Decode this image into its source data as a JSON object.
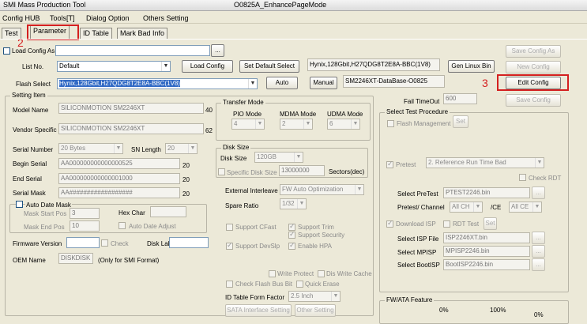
{
  "window": {
    "title": "SMI Mass Production Tool",
    "subtitle": "O0825A_EnhancePageMode"
  },
  "menu": [
    "Config HUB",
    "Tools[T]",
    "Dialog Option",
    "Others Setting"
  ],
  "tabs": [
    "Test",
    "Parameter",
    "ID Table",
    "Mark Bad Info"
  ],
  "annotations": {
    "n2": "2",
    "n3": "3"
  },
  "top": {
    "load_config_as": "Load Config As",
    "browse": "...",
    "list_no_label": "List No.",
    "list_no_value": "Default",
    "load_config": "Load Config",
    "set_default_select": "Set Default Select",
    "flash_info": "Hynix,128Gbit,H27QDG8T2E8A-BBC(1V8)",
    "gen_linux_bin": "Gen Linux Bin",
    "flash_select_label": "Flash Select",
    "flash_select_value": "Hynix,128Gbit,H27QDG8T2E8A-BBC(1V8)",
    "auto": "Auto",
    "manual": "Manual",
    "database": "SM2246XT-DataBase-O0825",
    "save_config_as": "Save Config As",
    "new_config": "New Config",
    "edit_config": "Edit Config",
    "fail_timeout_label": "Fail TimeOut",
    "fail_timeout_value": "600",
    "save_config": "Save Config"
  },
  "setting": {
    "title": "Setting Item",
    "model_name_label": "Model Name",
    "model_name": "SILICONMOTION SM2246XT",
    "model_len": "40",
    "vendor_label": "Vendor Specific",
    "vendor": "SILICONMOTION SM2246XT",
    "vendor_len": "62",
    "serial_number_label": "Serial Number",
    "serial_number": "20 Bytes",
    "sn_length_label": "SN Length",
    "sn_length": "20",
    "begin_serial_label": "Begin Serial",
    "begin_serial": "AA000000000000000525",
    "begin_len": "20",
    "end_serial_label": "End Serial",
    "end_serial": "AA000000000000001000",
    "end_len": "20",
    "serial_mask_label": "Serial Mask",
    "serial_mask": "AA##################",
    "mask_len": "20",
    "auto_date_mask": "Auto Date Mask",
    "mask_start_label": "Mask Start Pos",
    "mask_start": "3",
    "hex_char_label": "Hex Char",
    "mask_end_label": "Mask End Pos",
    "mask_end": "10",
    "auto_date_adjust": "Auto Date Adjust",
    "firmware_version_label": "Firmware Version",
    "check": "Check",
    "disk_label_label": "Disk Label",
    "oem_name_label": "OEM Name",
    "oem_name": "DISKDISK",
    "oem_note": "(Only for SMI Format)"
  },
  "transfer": {
    "title": "Transfer Mode",
    "pio_label": "PIO Mode",
    "pio": "4",
    "mdma_label": "MDMA Mode",
    "mdma": "2",
    "udma_label": "UDMA Mode",
    "udma": "6"
  },
  "disk": {
    "title": "Disk Size",
    "disk_size_label": "Disk Size",
    "disk_size": "120GB",
    "specific_label": "Specific Disk Size",
    "specific_value": "13000000",
    "sectors": "Sectors(dec)"
  },
  "external_interleave_label": "External Interleave",
  "external_interleave": "FW Auto Optimization",
  "spare_ratio_label": "Spare Ratio",
  "spare_ratio": "1/32",
  "features": {
    "cfast": "Support CFast",
    "trim": "Support Trim",
    "security": "Support Security",
    "devslp": "Support DevSlp",
    "hpa": "Enable HPA",
    "write_protect": "Write Protect",
    "dis_write_cache": "Dis Write Cache",
    "check_flash_bus_bit": "Check Flash Bus Bit",
    "quick_erase": "Quick Erase"
  },
  "id_table_form_factor_label": "ID Table Form Factor",
  "id_table_form_factor": "2.5 Inch",
  "sata_interface_setting": "SATA Interface Setting",
  "other_setting": "Other Setting",
  "test_proc": {
    "title": "Select Test Procedure",
    "flash_management": "Flash Management",
    "set": "Set",
    "pretest": "Pretest",
    "pretest_value": "2. Reference Run Time Bad",
    "check_rdt": "Check RDT",
    "select_pretest_label": "Select PreTest",
    "select_pretest": "PTEST2246.bin",
    "pretest_channel_label": "Pretest/ Channel",
    "channel": "All CH",
    "ce_label": "/CE",
    "ce": "All CE",
    "download_isp": "Download ISP",
    "rdt_test": "RDT Test",
    "set2": "Set",
    "select_isp_label": "Select ISP File",
    "select_isp": "ISP2246XT.bin",
    "select_mpisp_label": "Select MPISP",
    "select_mpisp": "MPISP2246.bin",
    "select_bootisp_label": "Select BootISP",
    "select_bootisp": "BootISP2246.bin"
  },
  "fw_ata": {
    "title": "FW/ATA Feature",
    "pct0": "0%",
    "pct100": "100%",
    "pct0b": "0%"
  },
  "colors": {
    "annotation_red": "#d42020",
    "selection": "#316ac5",
    "face": "#ece9d8"
  }
}
